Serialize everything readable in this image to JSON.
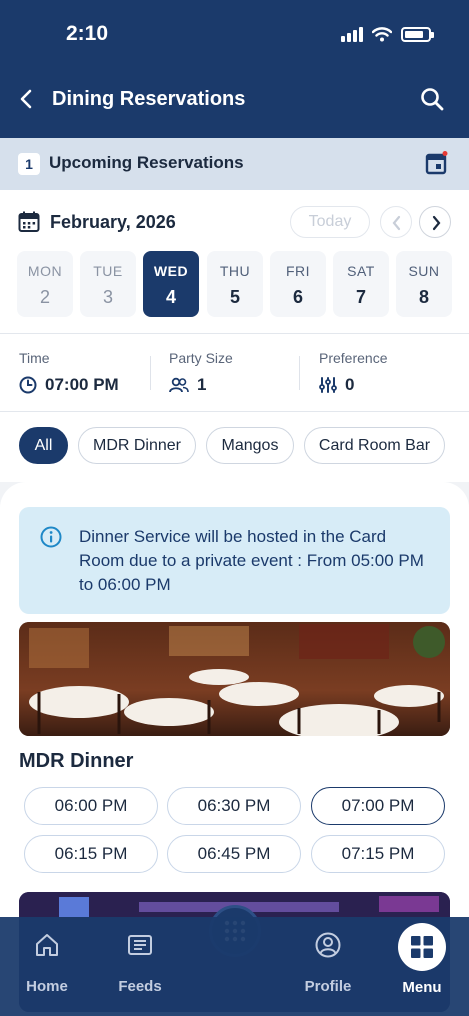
{
  "status_bar": {
    "time": "2:10"
  },
  "header": {
    "title": "Dining Reservations"
  },
  "upcoming": {
    "count": "1",
    "label": "Upcoming Reservations"
  },
  "calendar": {
    "month": "February, 2026",
    "today_label": "Today",
    "days": [
      {
        "name": "MON",
        "date": "2",
        "state": "past"
      },
      {
        "name": "TUE",
        "date": "3",
        "state": "past"
      },
      {
        "name": "WED",
        "date": "4",
        "state": "selected"
      },
      {
        "name": "THU",
        "date": "5",
        "state": "normal"
      },
      {
        "name": "FRI",
        "date": "6",
        "state": "normal"
      },
      {
        "name": "SAT",
        "date": "7",
        "state": "normal"
      },
      {
        "name": "SUN",
        "date": "8",
        "state": "normal"
      }
    ]
  },
  "filters": {
    "time_label": "Time",
    "time_value": "07:00 PM",
    "party_label": "Party Size",
    "party_value": "1",
    "pref_label": "Preference",
    "pref_value": "0"
  },
  "chips": [
    "All",
    "MDR Dinner",
    "Mangos",
    "Card Room Bar"
  ],
  "notice": "Dinner Service will be hosted in the Card Room due to a private event : From 05:00 PM to 06:00 PM",
  "venue": {
    "name": "MDR Dinner",
    "slots": [
      "06:00 PM",
      "06:30 PM",
      "07:00 PM",
      "06:15 PM",
      "06:45 PM",
      "07:15 PM"
    ],
    "selected_slot": "07:00 PM"
  },
  "tabbar": {
    "home": "Home",
    "feeds": "Feeds",
    "profile": "Profile",
    "menu": "Menu"
  },
  "colors": {
    "primary": "#1b3a6b",
    "notice_bg": "#d7ecf7",
    "upcoming_bg": "#d6e0ec"
  }
}
